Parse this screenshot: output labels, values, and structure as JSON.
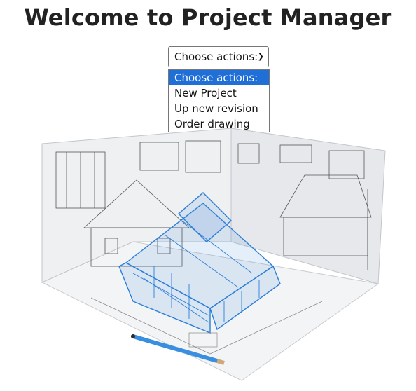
{
  "page": {
    "title": "Welcome to Project Manager"
  },
  "actions_select": {
    "selected": "Choose actions:",
    "options": [
      {
        "label": "Choose actions:"
      },
      {
        "label": "New Project"
      },
      {
        "label": "Up new revision"
      },
      {
        "label": "Order drawing"
      }
    ]
  },
  "image": {
    "alt": "3D house blueprint model"
  },
  "colors": {
    "accent": "#1f6fd6",
    "house_wireframe": "#2b7fd8"
  }
}
